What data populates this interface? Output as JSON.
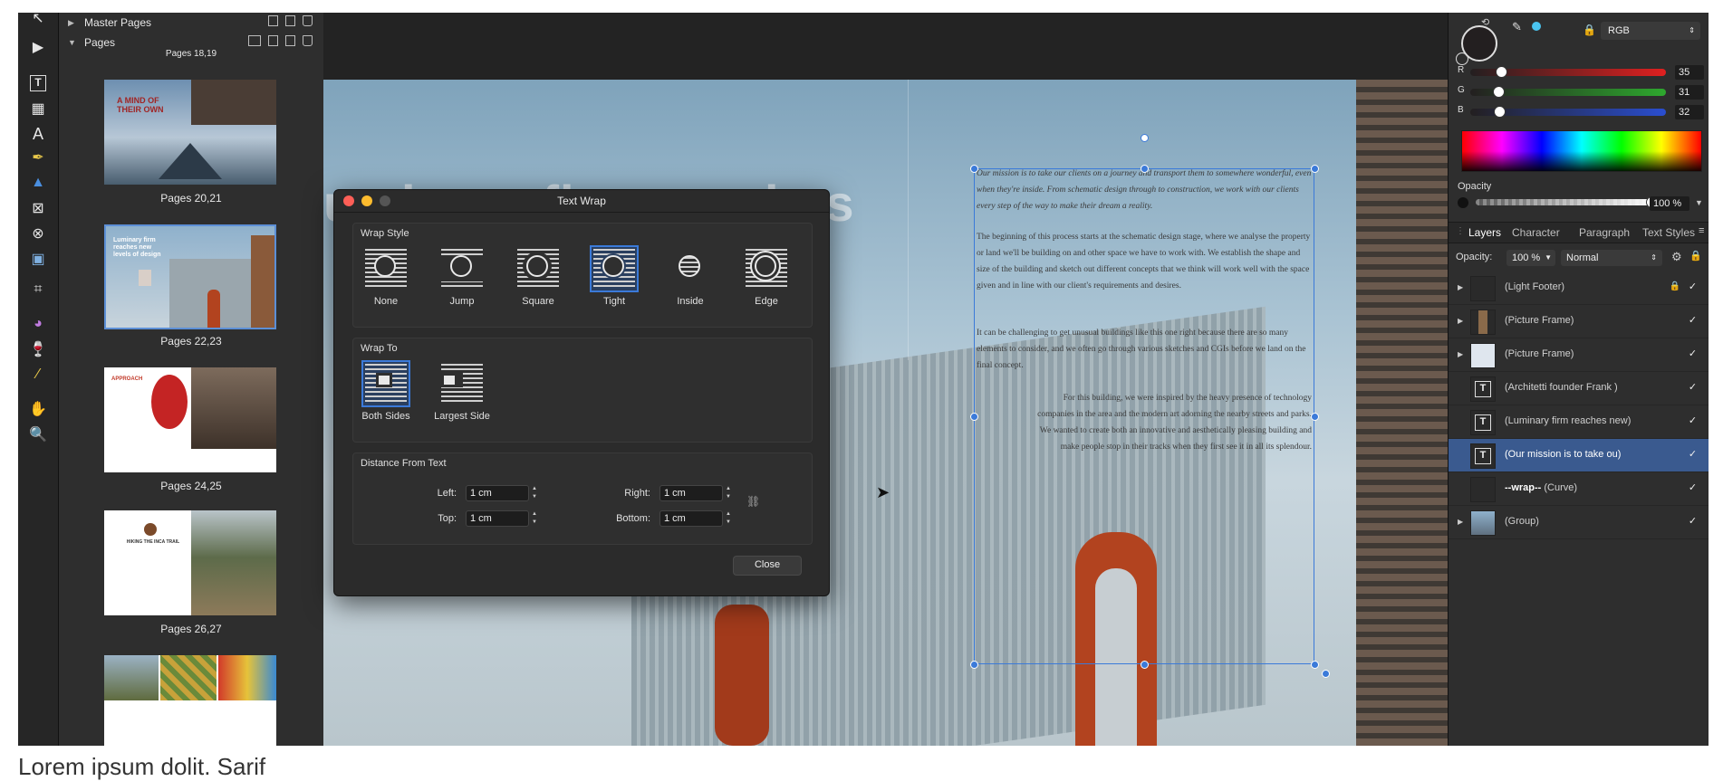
{
  "pages_panel": {
    "master_pages_label": "Master Pages",
    "pages_label": "Pages",
    "top_clipped_label": "Pages 18,19",
    "thumbnails": [
      {
        "label": "Pages 20,21",
        "title": "A MIND OF THEIR OWN"
      },
      {
        "label": "Pages 22,23",
        "title": "Luminary firm reaches new levels of design"
      },
      {
        "label": "Pages 24,25",
        "title": "APPROACH"
      },
      {
        "label": "Pages 26,27",
        "title": "HIKING THE INCA TRAIL"
      },
      {
        "label": ""
      }
    ]
  },
  "canvas": {
    "headline_line1": "uminary firm reaches",
    "headline_line2": "n",
    "body_paragraphs": [
      "Our mission is to take our clients on a journey and transport them to somewhere wonderful, even when they're inside. From schematic design through to construction, we work with our clients every step of the way to make their dream a reality.",
      "The beginning of this process starts at the schematic design stage, where we analyse the property or land we'll be building on and other space we have to work with. We establish the shape and size of the building and sketch out different concepts that we think will work well with the space given and in line with our client's requirements and desires.",
      "It can be challenging to get unusual buildings like this one right because there are so many elements to consider, and we often go through various sketches and CGIs before we land on the final concept.",
      "For this building, we were inspired by the heavy presence of technology companies in the area and the modern art adorning the nearby streets and parks. We wanted to create both an innovative and aesthetically pleasing building and make people stop in their tracks when they first see it in all its splendour."
    ]
  },
  "dialog": {
    "title": "Text Wrap",
    "wrap_style": {
      "label": "Wrap Style",
      "options": [
        "None",
        "Jump",
        "Square",
        "Tight",
        "Inside",
        "Edge"
      ],
      "selected": "Tight"
    },
    "wrap_to": {
      "label": "Wrap To",
      "options": [
        "Both Sides",
        "Largest Side"
      ],
      "selected": "Both Sides"
    },
    "distance": {
      "label": "Distance From Text",
      "left_label": "Left:",
      "left": "1 cm",
      "right_label": "Right:",
      "right": "1 cm",
      "top_label": "Top:",
      "top": "1 cm",
      "bottom_label": "Bottom:",
      "bottom": "1 cm"
    },
    "close_label": "Close"
  },
  "color": {
    "model": "RGB",
    "r_label": "R",
    "r": "35",
    "g_label": "G",
    "g": "31",
    "b_label": "B",
    "b": "32",
    "opacity_label": "Opacity",
    "opacity": "100 %",
    "swatch_color": "#231f20"
  },
  "layers_panel": {
    "tabs": [
      "Layers",
      "Character",
      "Paragraph",
      "Text Styles"
    ],
    "active_tab": "Layers",
    "opacity_label": "Opacity:",
    "opacity": "100 %",
    "blend_mode": "Normal",
    "layers": [
      {
        "name": "(Light Footer)",
        "expandable": true,
        "locked": true
      },
      {
        "name": "(Picture Frame)",
        "expandable": true
      },
      {
        "name": "(Picture Frame)",
        "expandable": true
      },
      {
        "name": "(Architetti founder Frank )",
        "text": true
      },
      {
        "name": "(Luminary firm reaches new)",
        "text": true
      },
      {
        "name": "(Our mission is to take ou)",
        "text": true,
        "selected": true
      },
      {
        "name_bold": "--wrap--",
        "name": " (Curve)"
      },
      {
        "name": "(Group)",
        "expandable": true
      }
    ]
  },
  "caption": "Lorem ipsum dolit. Sarif"
}
